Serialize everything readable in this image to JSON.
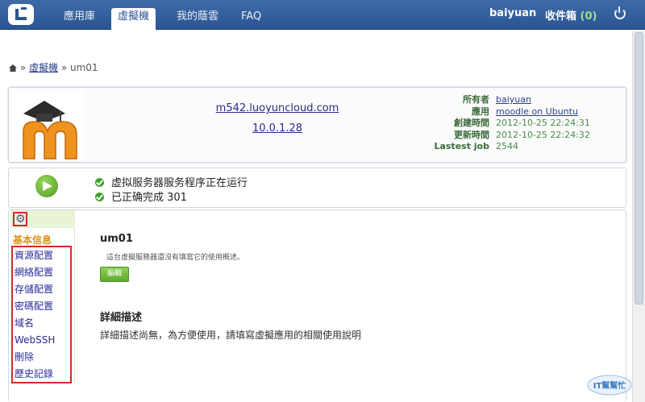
{
  "nav": {
    "items": [
      {
        "label": "應用庫"
      },
      {
        "label": "虛擬機"
      },
      {
        "label": "我的蔭雲"
      },
      {
        "label": "FAQ"
      }
    ],
    "user": "baiyuan",
    "inbox_label": "收件箱",
    "inbox_count": "(0)"
  },
  "breadcrumb": {
    "sep": "»",
    "vm_link": "虛擬機",
    "current": "um01"
  },
  "info": {
    "domain": "m542.luoyuncloud.com",
    "ip": "10.0.1.28",
    "meta": [
      {
        "label": "所有者",
        "value": "baiyuan",
        "link": true
      },
      {
        "label": "應用",
        "value": "moodle on Ubuntu",
        "link": true
      },
      {
        "label": "創建時間",
        "value": "2012-10-25 22:24:31",
        "link": false
      },
      {
        "label": "更新時間",
        "value": "2012-10-25 22:24:32",
        "link": false
      },
      {
        "label": "Lastest job",
        "value": "2544",
        "link": false
      }
    ]
  },
  "status": {
    "line1": "虚拟服务器服务程序正在运行",
    "line2": "已正确完成 301"
  },
  "side": {
    "heading": "基本信息",
    "items": [
      "資源配置",
      "網絡配置",
      "存儲配置",
      "密碼配置",
      "域名",
      "WebSSH",
      "刪除",
      "歷史記錄"
    ]
  },
  "main": {
    "vm_name": "um01",
    "description": "這台虛擬服務器還沒有填寫它的使用概述。",
    "edit_label": "編輯",
    "detail_title": "詳細描述",
    "detail_text": "詳細描述尚無，為方便使用，請填寫虛擬應用的相關使用說明"
  },
  "watermark": "IT幫幫忙",
  "colors": {
    "topbar": "#2b5592",
    "accent_green": "#5fa92c",
    "highlight_red": "#d42a2a",
    "side_heading": "#e0901c"
  }
}
